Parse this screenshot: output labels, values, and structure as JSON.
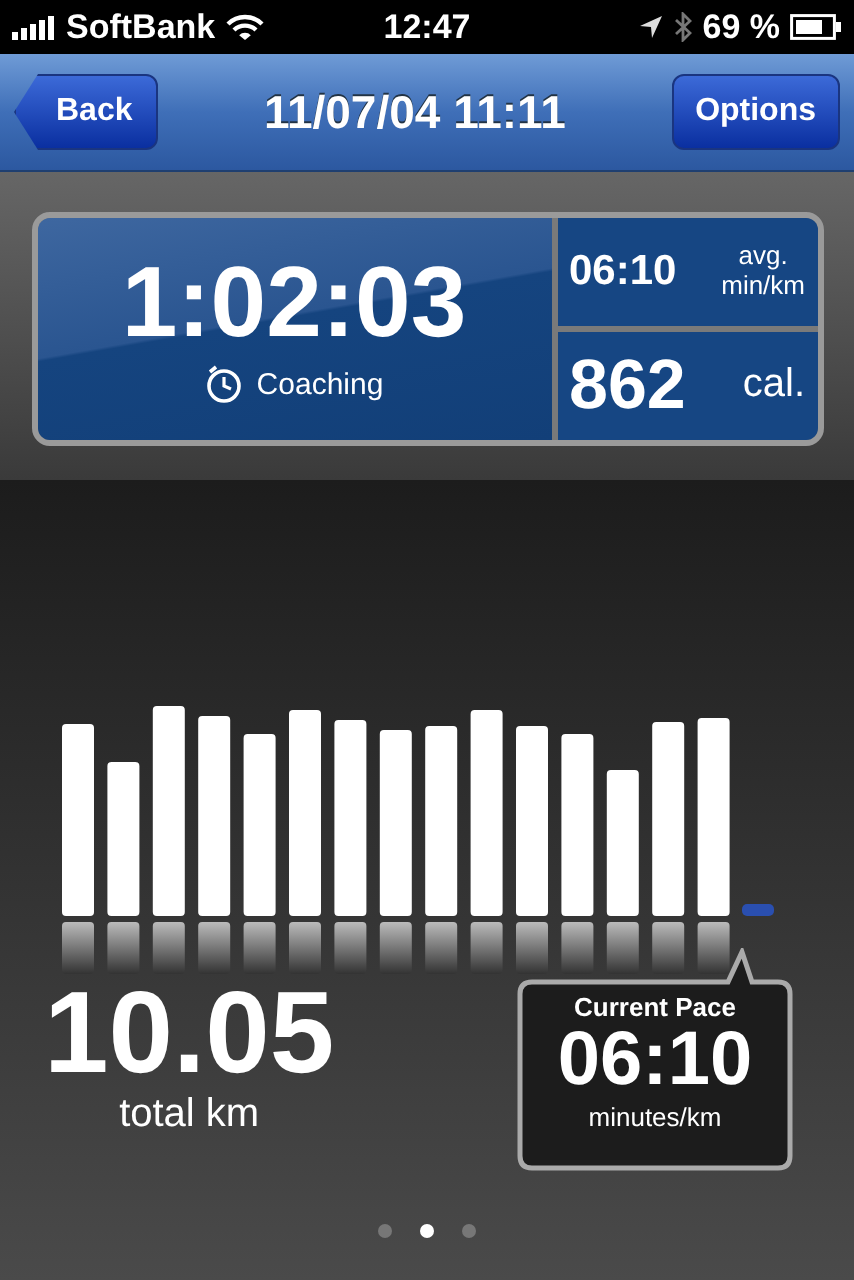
{
  "status_bar": {
    "carrier": "SoftBank",
    "time": "12:47",
    "battery": "69 %"
  },
  "nav_bar": {
    "back": "Back",
    "title": "11/07/04 11:11",
    "options": "Options"
  },
  "stats": {
    "duration": "1:02:03",
    "coaching": "Coaching",
    "avg_pace": "06:10",
    "avg_unit_1": "avg.",
    "avg_unit_2": "min/km",
    "calories": "862",
    "calories_unit": "cal."
  },
  "distance": {
    "value": "10.05",
    "label": "total km"
  },
  "current_pace": {
    "title": "Current Pace",
    "value": "06:10",
    "unit": "minutes/km"
  },
  "page_dots": [
    {
      "selected": false
    },
    {
      "selected": true
    },
    {
      "selected": false
    }
  ]
}
